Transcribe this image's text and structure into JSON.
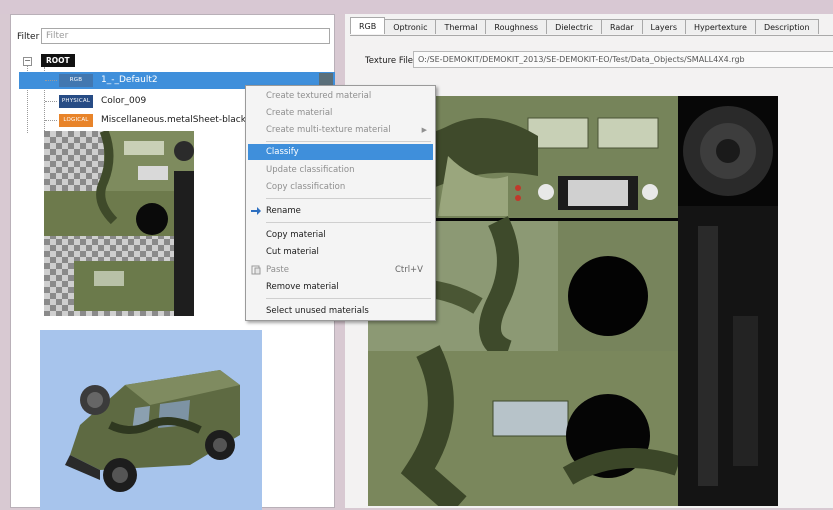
{
  "filter": {
    "label": "Filter",
    "placeholder": "Filter"
  },
  "tree": {
    "root": "ROOT",
    "items": [
      {
        "badge": "RGB",
        "label": "1_-_Default2",
        "selected": true
      },
      {
        "badge": "PHYSICAL",
        "label": "Color_009"
      },
      {
        "badge": "LOGICAL",
        "label": "Miscellaneous.metalSheet-black"
      }
    ]
  },
  "tabs": [
    "RGB",
    "Optronic",
    "Thermal",
    "Roughness",
    "Dielectric",
    "Radar",
    "Layers",
    "Hypertexture",
    "Description"
  ],
  "texture_file": {
    "label": "Texture File",
    "value": "O:/SE-DEMOKIT/DEMOKIT_2013/SE-DEMOKIT-EO/Test/Data_Objects/SMALL4X4.rgb"
  },
  "context_menu": {
    "items": [
      {
        "label": "Create textured material",
        "disabled": true
      },
      {
        "label": "Create material",
        "disabled": true
      },
      {
        "label": "Create multi-texture material",
        "disabled": true,
        "submenu": true
      },
      {
        "label": "Classify",
        "highlighted": true
      },
      {
        "label": "Update classification",
        "disabled": true
      },
      {
        "label": "Copy classification",
        "disabled": true
      },
      {
        "label": "Rename",
        "icon": "rename-icon"
      },
      {
        "label": "Copy material"
      },
      {
        "label": "Cut material"
      },
      {
        "label": "Paste",
        "disabled": true,
        "shortcut": "Ctrl+V",
        "icon": "paste-icon"
      },
      {
        "label": "Remove material"
      },
      {
        "label": "Select unused materials"
      }
    ]
  },
  "colors": {
    "selection": "#3f8fdb",
    "camo_green": "#7d8a5c",
    "badge_logical": "#e8842a"
  }
}
